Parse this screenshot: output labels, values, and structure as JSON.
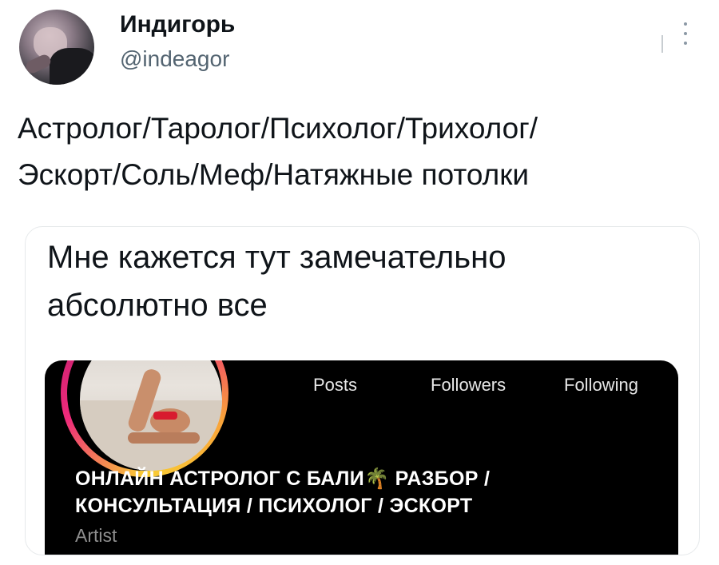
{
  "author": {
    "display_name": "Индигорь",
    "handle": "@indeagor"
  },
  "tweet_text": "Астролог/Таролог/Психолог/Трихолог/\nЭскорт/Соль/Меф/Натяжные потолки",
  "quoted": {
    "text": "Мне кажется тут замечательно\nабсолютно все",
    "profile": {
      "stats": [
        {
          "label": "Posts"
        },
        {
          "label": "Followers"
        },
        {
          "label": "Following"
        }
      ],
      "bio_line1": "ОНЛАЙН АСТРОЛОГ С БАЛИ",
      "bio_emoji": "🌴",
      "bio_line1_end": "РАЗБОР /",
      "bio_line2": "КОНСУЛЬТАЦИЯ / ПСИХОЛОГ / ЭСКОРТ",
      "category": "Artist"
    }
  },
  "icons": [
    "more-options-icon"
  ],
  "colors": {
    "text": "#0f1419",
    "secondary": "#536471",
    "profile_bg": "#000000",
    "story_ring_start": "#f9ce34",
    "story_ring_mid": "#ee2a7b"
  }
}
